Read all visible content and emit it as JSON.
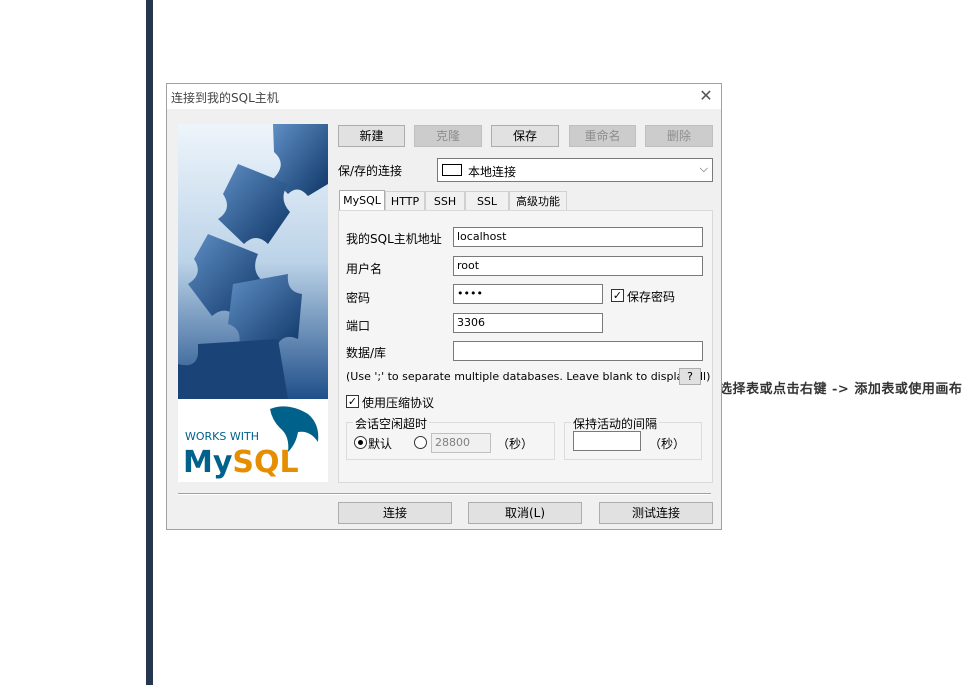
{
  "background": {
    "overflow_text": "选择表或点击右键 -> 添加表或使用画布"
  },
  "dialog": {
    "title": "连接到我的SQL主机",
    "banner_text": {
      "works_with": "WORKS WITH",
      "logo": "MySQL"
    },
    "toolbar": {
      "new": "新建",
      "clone": "克隆",
      "save": "保存",
      "rename": "重命名",
      "delete": "删除"
    },
    "saved_connection": {
      "label": "保/存的连接",
      "value": "本地连接"
    },
    "tabs": [
      "MySQL",
      "HTTP",
      "SSH",
      "SSL",
      "高级功能"
    ],
    "form": {
      "host": {
        "label": "我的SQL主机地址",
        "value": "localhost"
      },
      "username": {
        "label": "用户名",
        "value": "root"
      },
      "password": {
        "label": "密码",
        "value": "••••",
        "save_label": "保存密码"
      },
      "port": {
        "label": "端口",
        "value": "3306"
      },
      "database": {
        "label": "数据/库",
        "value": ""
      },
      "database_hint": "(Use ';' to separate multiple databases. Leave blank to display all)",
      "help_button": "?",
      "compression_label": "使用压缩协议",
      "session_timeout": {
        "title": "会话空闲超时",
        "default_label": "默认",
        "custom_value": "28800",
        "unit": "（秒）"
      },
      "keepalive": {
        "title": "保持活动的间隔",
        "value": "",
        "unit": "（秒）"
      }
    },
    "footer": {
      "connect": "连接",
      "cancel": "取消(L)",
      "test": "测试连接"
    }
  },
  "colors": {
    "left_bar": "#27364f",
    "dialog_bg": "#f0f0f0",
    "mysql_blue": "#00618a",
    "mysql_orange": "#e48e00"
  }
}
